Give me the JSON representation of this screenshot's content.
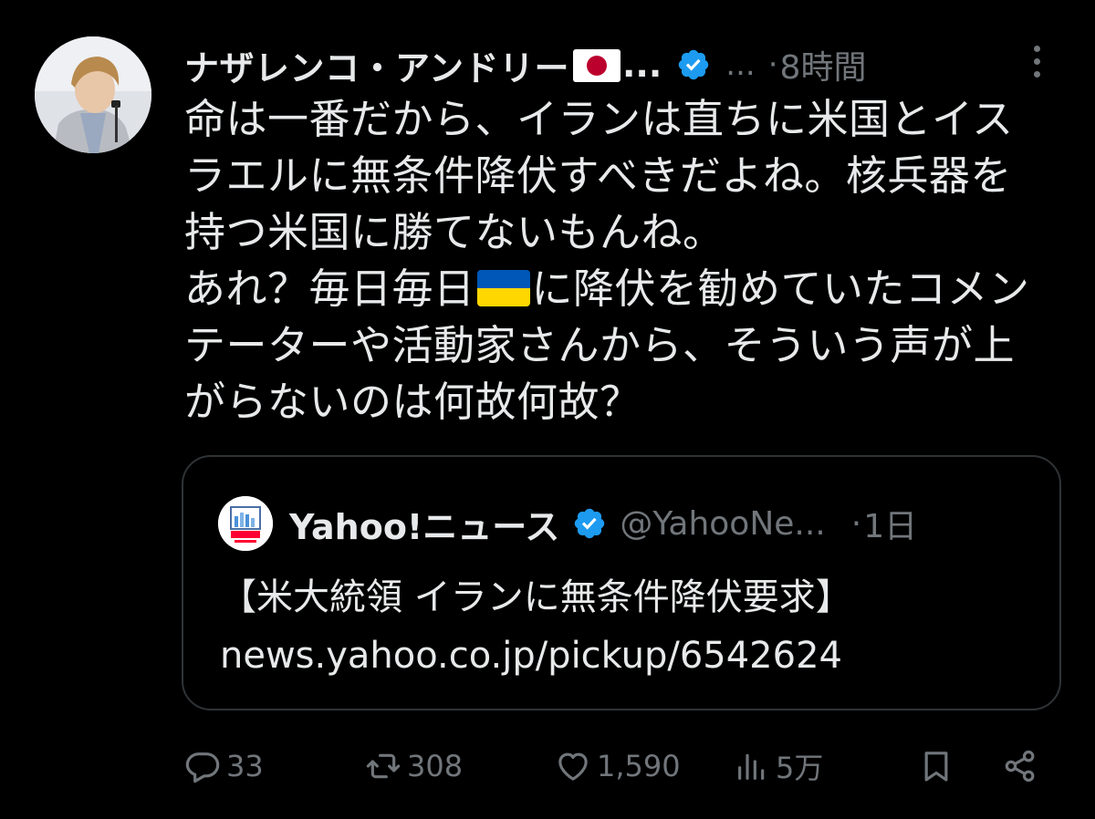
{
  "tweet": {
    "author": {
      "display_name": "ナザレンコ・アンドリー",
      "name_truncation": "...",
      "flag_emoji": "japan-flag",
      "handle": "...",
      "separator": "·",
      "time": "8時間"
    },
    "body_lines": [
      "命は一番だから、イランは直ちに米国とイス",
      "ラエルに無条件降伏すべきだよね。核兵器を",
      "持つ米国に勝てないもんね。",
      "あれ？毎日毎日",
      "に降伏を勧めていたコメン",
      "テーターや活動家さんから、そういう声が上",
      "がらないのは何故何故？"
    ],
    "inline_emoji": "ukraine-flag",
    "quote": {
      "display_name": "Yahoo!ニュース",
      "handle": "@YahooNe...",
      "separator": "·",
      "time": "1日",
      "headline": "【米大統領 イランに無条件降伏要求】",
      "link": "news.yahoo.co.jp/pickup/6542624",
      "avatar_icon": "yahoo-news-logo"
    },
    "actions": {
      "reply_count": "33",
      "repost_count": "308",
      "like_count": "1,590",
      "views_count": "5万"
    }
  },
  "colors": {
    "background": "#000000",
    "primary_text": "#e7e9ea",
    "secondary_text": "#71767b",
    "verified_blue": "#1d9bf0",
    "border": "#2f3336"
  },
  "icons": [
    "more-icon",
    "verified-icon",
    "reply-icon",
    "repost-icon",
    "like-icon",
    "views-icon",
    "bookmark-icon",
    "share-icon"
  ]
}
